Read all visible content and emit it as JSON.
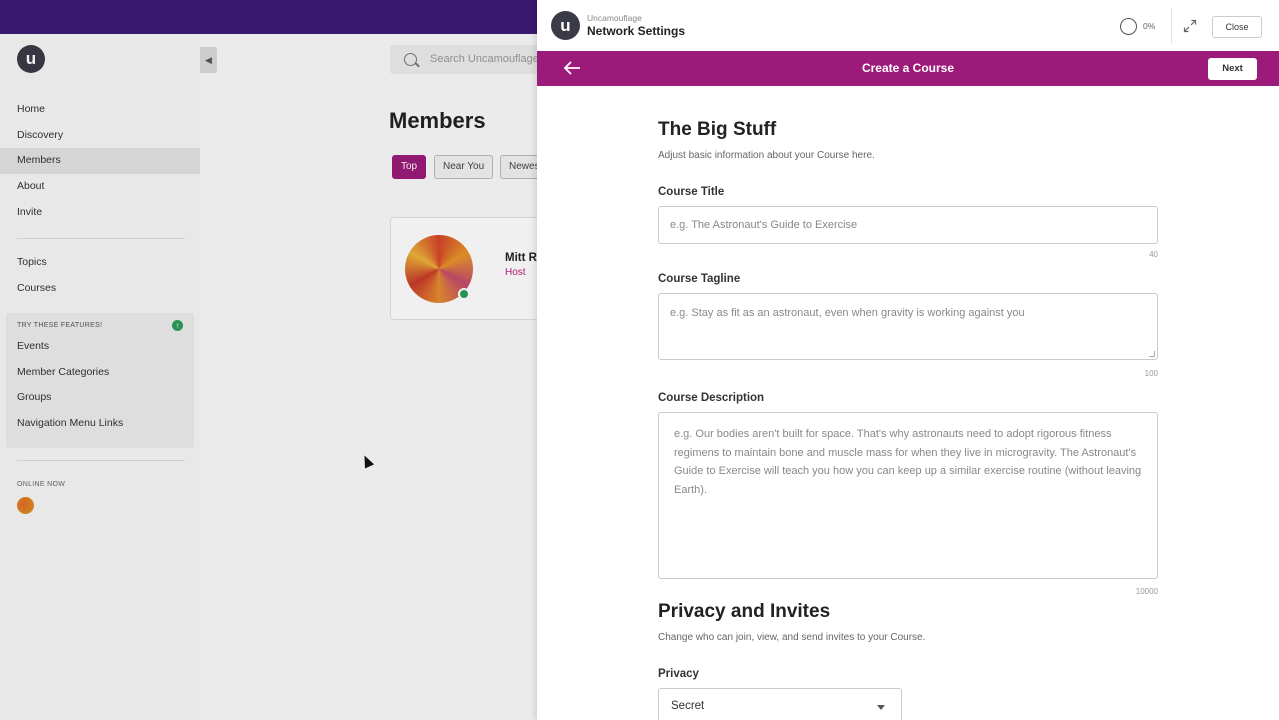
{
  "sidebar": {
    "logo_letter": "u",
    "items": [
      {
        "label": "Home"
      },
      {
        "label": "Discovery"
      },
      {
        "label": "Members"
      },
      {
        "label": "About"
      },
      {
        "label": "Invite"
      }
    ],
    "items2": [
      {
        "label": "Topics"
      },
      {
        "label": "Courses"
      }
    ],
    "try_title": "TRY THESE FEATURES!",
    "try_badge": "↑",
    "try_items": [
      {
        "label": "Events"
      },
      {
        "label": "Member Categories"
      },
      {
        "label": "Groups"
      },
      {
        "label": "Navigation Menu Links"
      }
    ],
    "online_label": "ONLINE NOW"
  },
  "main": {
    "search_placeholder": "Search Uncamouflage",
    "title": "Members",
    "filters": [
      "Top",
      "Near You",
      "Newest"
    ],
    "member": {
      "name": "Mitt R",
      "role": "Host"
    }
  },
  "panel": {
    "logo_letter": "u",
    "subtitle": "Uncamouflage",
    "title": "Network Settings",
    "progress": "0%",
    "close_label": "Close",
    "bar_title": "Create a Course",
    "next_label": "Next"
  },
  "form": {
    "section1_title": "The Big Stuff",
    "section1_desc": "Adjust basic information about your Course here.",
    "course_title_label": "Course Title",
    "course_title_placeholder": "e.g. The Astronaut's Guide to Exercise",
    "course_title_max": "40",
    "tagline_label": "Course Tagline",
    "tagline_placeholder": "e.g. Stay as fit as an astronaut, even when gravity is working against you",
    "tagline_max": "100",
    "description_label": "Course Description",
    "description_placeholder": "e.g. Our bodies aren't built for space. That's why astronauts need to adopt rigorous fitness regimens to maintain bone and muscle mass for when they live in microgravity. The Astronaut's Guide to Exercise will teach you how you can keep up a similar exercise routine (without leaving Earth).",
    "description_max": "10000",
    "section2_title": "Privacy and Invites",
    "section2_desc": "Change who can join, view, and send invites to your Course.",
    "privacy_label": "Privacy",
    "privacy_value": "Secret"
  }
}
